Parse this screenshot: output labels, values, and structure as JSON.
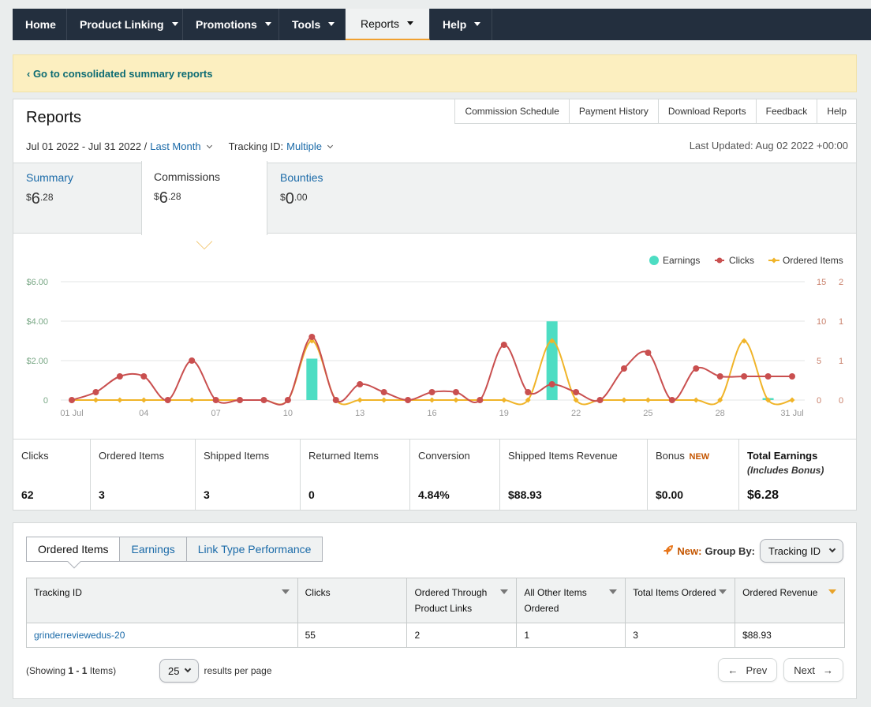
{
  "nav": {
    "items": [
      {
        "label": "Home",
        "caret": false,
        "active": false,
        "width": 69
      },
      {
        "label": "Product Linking",
        "caret": true,
        "active": false,
        "width": 147
      },
      {
        "label": "Promotions",
        "caret": true,
        "active": false,
        "width": 122
      },
      {
        "label": "Tools",
        "caret": true,
        "active": false,
        "width": 84
      },
      {
        "label": "Reports",
        "caret": true,
        "active": true,
        "width": 107
      },
      {
        "label": "Help",
        "caret": true,
        "active": false,
        "width": 79
      }
    ]
  },
  "banner": {
    "link_text": "‹ Go to consolidated summary reports"
  },
  "reports": {
    "title": "Reports",
    "subtabs": [
      "Commission Schedule",
      "Payment History",
      "Download Reports",
      "Feedback",
      "Help"
    ],
    "date_range": "Jul 01 2022 - Jul 31 2022 /",
    "period": "Last Month",
    "tracking_label": "Tracking ID:",
    "tracking_value": "Multiple",
    "last_updated": "Last Updated: Aug 02 2022 +00:00",
    "summary_tabs": [
      {
        "label": "Summary",
        "currency": "$",
        "whole": "6",
        "cents": ".28"
      },
      {
        "label": "Commissions",
        "currency": "$",
        "whole": "6",
        "cents": ".28"
      },
      {
        "label": "Bounties",
        "currency": "$",
        "whole": "0",
        "cents": ".00"
      }
    ]
  },
  "chart_data": {
    "type": "line",
    "legend": [
      "Earnings",
      "Clicks",
      "Ordered Items"
    ],
    "legend_position": "top-right",
    "colors": {
      "earnings": "#4dddc3",
      "clicks": "#c94f4f",
      "ordered": "#f0b429",
      "left_axis": "#7aa886",
      "right_axis": "#c9806b"
    },
    "y_left_ticks": [
      "$6.00",
      "$4.00",
      "$2.00",
      "0"
    ],
    "y_left_max": 6,
    "y_right1_ticks": [
      "15",
      "10",
      "5",
      "0"
    ],
    "y_right1_max": 15,
    "y_right2_ticks": [
      "2",
      "1",
      "1",
      "0"
    ],
    "y_right2_max": 2,
    "x_tick_labels": [
      {
        "day": 1,
        "label": "01 Jul"
      },
      {
        "day": 4,
        "label": "04"
      },
      {
        "day": 7,
        "label": "07"
      },
      {
        "day": 10,
        "label": "10"
      },
      {
        "day": 13,
        "label": "13"
      },
      {
        "day": 16,
        "label": "16"
      },
      {
        "day": 19,
        "label": "19"
      },
      {
        "day": 22,
        "label": "22"
      },
      {
        "day": 25,
        "label": "25"
      },
      {
        "day": 28,
        "label": "28"
      },
      {
        "day": 31,
        "label": "31 Jul"
      }
    ],
    "days": [
      1,
      2,
      3,
      4,
      5,
      6,
      7,
      8,
      9,
      10,
      11,
      12,
      13,
      14,
      15,
      16,
      17,
      18,
      19,
      20,
      21,
      22,
      23,
      24,
      25,
      26,
      27,
      28,
      29,
      30,
      31
    ],
    "earnings": [
      0,
      0,
      0,
      0,
      0,
      0,
      0,
      0,
      0,
      0,
      2.1,
      0,
      0,
      0,
      0,
      0,
      0,
      0,
      0,
      0,
      3.99,
      0,
      0,
      0,
      0,
      0,
      0,
      0,
      0,
      0.1,
      0
    ],
    "clicks": [
      0,
      1,
      3,
      3,
      0,
      5,
      0,
      0,
      0,
      0,
      8,
      0,
      2,
      1,
      0,
      1,
      1,
      0,
      7,
      1,
      2,
      1,
      0,
      4,
      6,
      0,
      4,
      3,
      3,
      3,
      3
    ],
    "ordered_items": [
      0,
      0,
      0,
      0,
      0,
      0,
      0,
      0,
      0,
      0,
      1,
      0,
      0,
      0,
      0,
      0,
      0,
      0,
      0,
      0,
      1,
      0,
      0,
      0,
      0,
      0,
      0,
      0,
      1,
      0,
      0
    ]
  },
  "metrics": [
    {
      "label": "Clicks",
      "value": "62"
    },
    {
      "label": "Ordered Items",
      "value": "3"
    },
    {
      "label": "Shipped Items",
      "value": "3"
    },
    {
      "label": "Returned Items",
      "value": "0"
    },
    {
      "label": "Conversion",
      "value": "4.84%"
    },
    {
      "label": "Shipped Items Revenue",
      "value": "$88.93"
    },
    {
      "label": "Bonus",
      "badge": "NEW",
      "value": "$0.00"
    },
    {
      "label": "Total Earnings",
      "sub": "(Includes Bonus)",
      "value": "$6.28"
    }
  ],
  "table_panel": {
    "tabs": [
      "Ordered Items",
      "Earnings",
      "Link Type Performance"
    ],
    "new_label": "New:",
    "group_by_label": "Group By:",
    "group_by_value": "Tracking ID",
    "headers": [
      "Tracking ID",
      "Clicks",
      "Ordered Through Product Links",
      "All Other Items Ordered",
      "Total Items Ordered",
      "Ordered Revenue"
    ],
    "rows": [
      [
        "grinderreviewedus-20",
        "55",
        "2",
        "1",
        "3",
        "$88.93"
      ]
    ],
    "showing_prefix": "(Showing ",
    "showing_range": "1 - 1",
    "showing_suffix": " Items)",
    "per_page_value": "25",
    "per_page_label": "results per page",
    "prev_label": "Prev",
    "next_label": "Next"
  }
}
